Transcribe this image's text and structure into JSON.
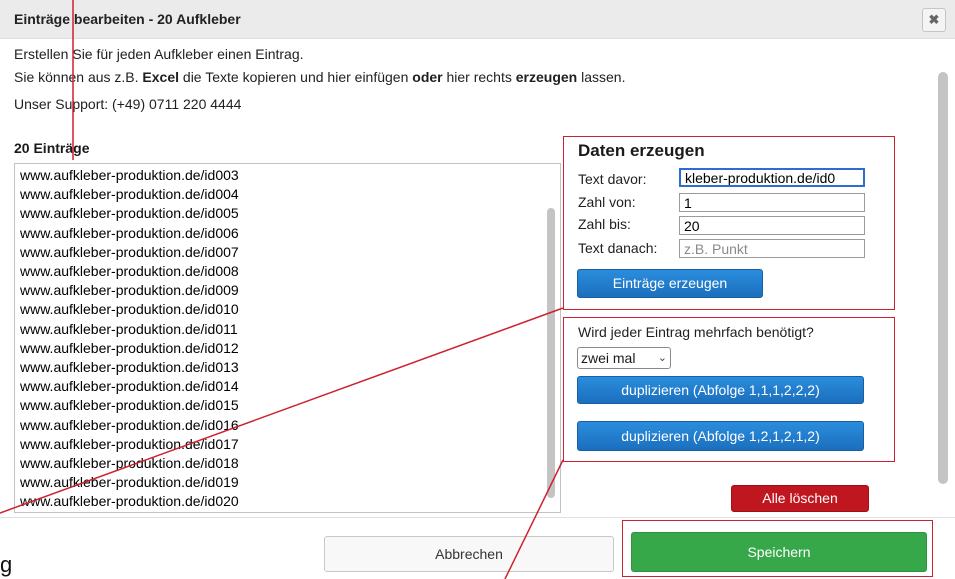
{
  "dialog": {
    "title": "Einträge bearbeiten - 20 Aufkleber",
    "close_icon": "close-icon"
  },
  "intro": {
    "line1": "Erstellen Sie für jeden Aufkleber einen Eintrag.",
    "line2": {
      "part1": "Sie können aus z.B. ",
      "bold1": "Excel",
      "part2": " die Texte kopieren und hier einfügen ",
      "bold2": "oder",
      "part3": " hier rechts ",
      "bold3": "erzeugen",
      "part4": " lassen."
    },
    "line3": "Unser Support: (+49) 0711 220 4444"
  },
  "entries": {
    "count_label": "20 Einträge",
    "items": [
      "www.aufkleber-produktion.de/id003",
      "www.aufkleber-produktion.de/id004",
      "www.aufkleber-produktion.de/id005",
      "www.aufkleber-produktion.de/id006",
      "www.aufkleber-produktion.de/id007",
      "www.aufkleber-produktion.de/id008",
      "www.aufkleber-produktion.de/id009",
      "www.aufkleber-produktion.de/id010",
      "www.aufkleber-produktion.de/id011",
      "www.aufkleber-produktion.de/id012",
      "www.aufkleber-produktion.de/id013",
      "www.aufkleber-produktion.de/id014",
      "www.aufkleber-produktion.de/id015",
      "www.aufkleber-produktion.de/id016",
      "www.aufkleber-produktion.de/id017",
      "www.aufkleber-produktion.de/id018",
      "www.aufkleber-produktion.de/id019",
      "www.aufkleber-produktion.de/id020"
    ]
  },
  "generator": {
    "title": "Daten erzeugen",
    "text_before": {
      "label": "Text davor:",
      "value": "kleber-produktion.de/id0"
    },
    "number_from": {
      "label": "Zahl von:",
      "value": "1"
    },
    "number_to": {
      "label": "Zahl bis:",
      "value": "20"
    },
    "text_after": {
      "label": "Text danach:",
      "value": "",
      "placeholder": "z.B. Punkt"
    },
    "button": "Einträge erzeugen"
  },
  "duplicate": {
    "question": "Wird jeder Eintrag mehrfach benötigt?",
    "select_value": "zwei mal",
    "button_sequence_1": "duplizieren (Abfolge 1,1,1,2,2,2)",
    "button_sequence_2": "duplizieren (Abfolge 1,2,1,2,1,2)"
  },
  "actions": {
    "delete_all": "Alle löschen",
    "cancel": "Abbrechen",
    "save": "Speichern"
  },
  "overlay": {
    "stray_glyph": "g"
  },
  "colors": {
    "highlight": "#cc2230",
    "primary": "#1b6fbd",
    "danger": "#c0161f",
    "success": "#37a84a"
  }
}
